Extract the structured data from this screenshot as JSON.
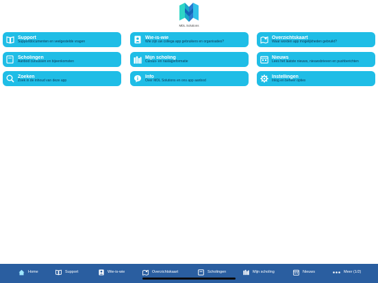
{
  "brand": {
    "name": "MDL Solutions"
  },
  "tiles": [
    {
      "title": "Support",
      "subtitle": "Supportdocumenten en veelgestelde vragen",
      "icon": "book-icon"
    },
    {
      "title": "Wie-is-wie",
      "subtitle": "Wie zijn uw collega app gebruikers en organisaties?",
      "icon": "person-badge-icon"
    },
    {
      "title": "Overzichtskaart",
      "subtitle": "Waar worden app mogelijkheden gebruikt?",
      "icon": "map-icon"
    },
    {
      "title": "Scholingen",
      "subtitle": "Aanbod cursussen en bijeenkomsten",
      "icon": "book-closed-icon"
    },
    {
      "title": "Mijn scholing",
      "subtitle": "Cursus- en naslaginformatie",
      "icon": "books-icon"
    },
    {
      "title": "Nieuws",
      "subtitle": "Lees het laatste nieuws, nieuwsbrieven en pushberichten",
      "icon": "calendar-icon"
    },
    {
      "title": "Zoeken",
      "subtitle": "Zoek in de inhoud van deze app",
      "icon": "search-icon"
    },
    {
      "title": "Info",
      "subtitle": "Over MDL Solutions en ons app aanbod",
      "icon": "chat-info-icon"
    },
    {
      "title": "Instellingen",
      "subtitle": "Inlog en beheer opties",
      "icon": "gear-icon"
    }
  ],
  "tabbar": [
    {
      "label": "Home",
      "icon": "home-icon"
    },
    {
      "label": "Support",
      "icon": "book-icon"
    },
    {
      "label": "Wie-is-wie",
      "icon": "person-badge-icon"
    },
    {
      "label": "Overzichtskaart",
      "icon": "map-icon"
    },
    {
      "label": "Scholingen",
      "icon": "book-closed-icon"
    },
    {
      "label": "Mijn scholing",
      "icon": "books-icon"
    },
    {
      "label": "Nieuws",
      "icon": "calendar-icon"
    },
    {
      "label": "Meer (1/2)",
      "icon": "more-dots-icon"
    }
  ],
  "colors": {
    "tile_bg": "#1fbde6",
    "tab_bar": "#2a5ea0",
    "tile_title": "#ffffff",
    "tile_subtitle": "#0b3550"
  }
}
